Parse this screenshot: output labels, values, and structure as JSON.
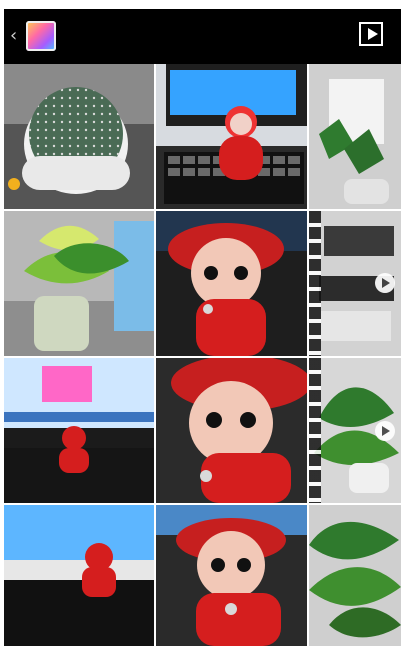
{
  "topbar": {
    "back_icon": "chevron-left-icon",
    "app_icon": "gallery-icon",
    "slideshow_icon": "play-icon"
  },
  "grid": {
    "columns": 3,
    "rows": 4,
    "items": [
      {
        "subject": "cactus",
        "type": "photo"
      },
      {
        "subject": "doll-at-computer",
        "type": "photo"
      },
      {
        "subject": "desk-plant-phone",
        "type": "photo"
      },
      {
        "subject": "plant-and-bottle",
        "type": "photo"
      },
      {
        "subject": "doll-closeup",
        "type": "photo"
      },
      {
        "subject": "desk-video",
        "type": "video"
      },
      {
        "subject": "doll-on-keyboard-screen",
        "type": "photo"
      },
      {
        "subject": "doll-closeup-2",
        "type": "photo"
      },
      {
        "subject": "plant-video",
        "type": "video"
      },
      {
        "subject": "doll-on-keyboard",
        "type": "photo"
      },
      {
        "subject": "doll-closeup-3",
        "type": "photo"
      },
      {
        "subject": "plant-closeup",
        "type": "photo"
      }
    ]
  }
}
